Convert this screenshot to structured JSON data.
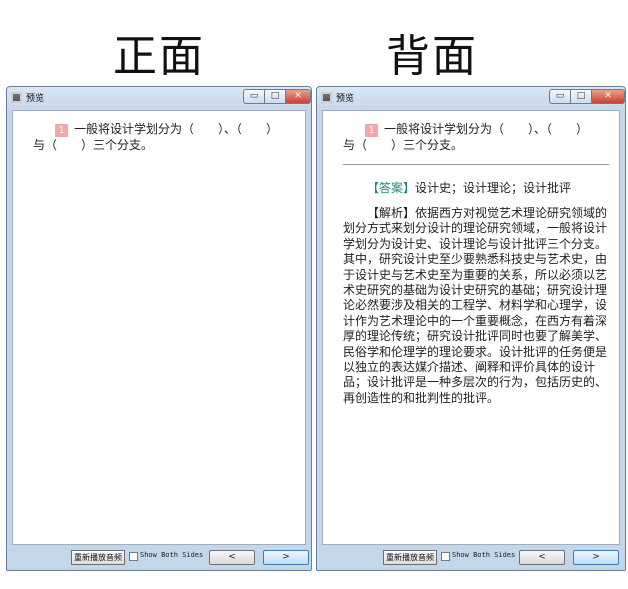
{
  "headings": {
    "front": "正面",
    "back": "背面"
  },
  "window": {
    "title": "预览",
    "controls": {
      "minimize": "▭",
      "maximize": "□",
      "close": "✕"
    }
  },
  "question": {
    "number": "1",
    "text": "一般将设计学划分为（　　）、（　　）与（　　）三个分支。"
  },
  "answer": {
    "label": "【答案】",
    "text": "设计史；设计理论；设计批评"
  },
  "analysis": {
    "text": "【解析】依据西方对视觉艺术理论研究领域的划分方式来划分设计的理论研究领域，一般将设计学划分为设计史、设计理论与设计批评三个分支。其中，研究设计史至少要熟悉科技史与艺术史，由于设计史与艺术史至为重要的关系，所以必须以艺术史研究的基础为设计史研究的基础；研究设计理论必然要涉及相关的工程学、材料学和心理学，设计作为艺术理论中的一个重要概念，在西方有着深厚的理论传统；研究设计批评同时也要了解美学、民俗学和伦理学的理论要求。设计批评的任务便是以独立的表达媒介描述、阐释和评价具体的设计品；设计批评是一种多层次的行为，包括历史的、再创造性的和批判性的批评。"
  },
  "bottombar": {
    "replay_label": "重新播放音频",
    "show_both_sides_label": "Show Both Sides",
    "show_both_sides_checked": false,
    "prev_label": "<",
    "next_label": ">"
  },
  "colors": {
    "accent_answer": "#1a8a7c",
    "question_badge": "#f4a7a7",
    "close_button": "#c8432f",
    "titlebar": "#c4d6ea"
  }
}
